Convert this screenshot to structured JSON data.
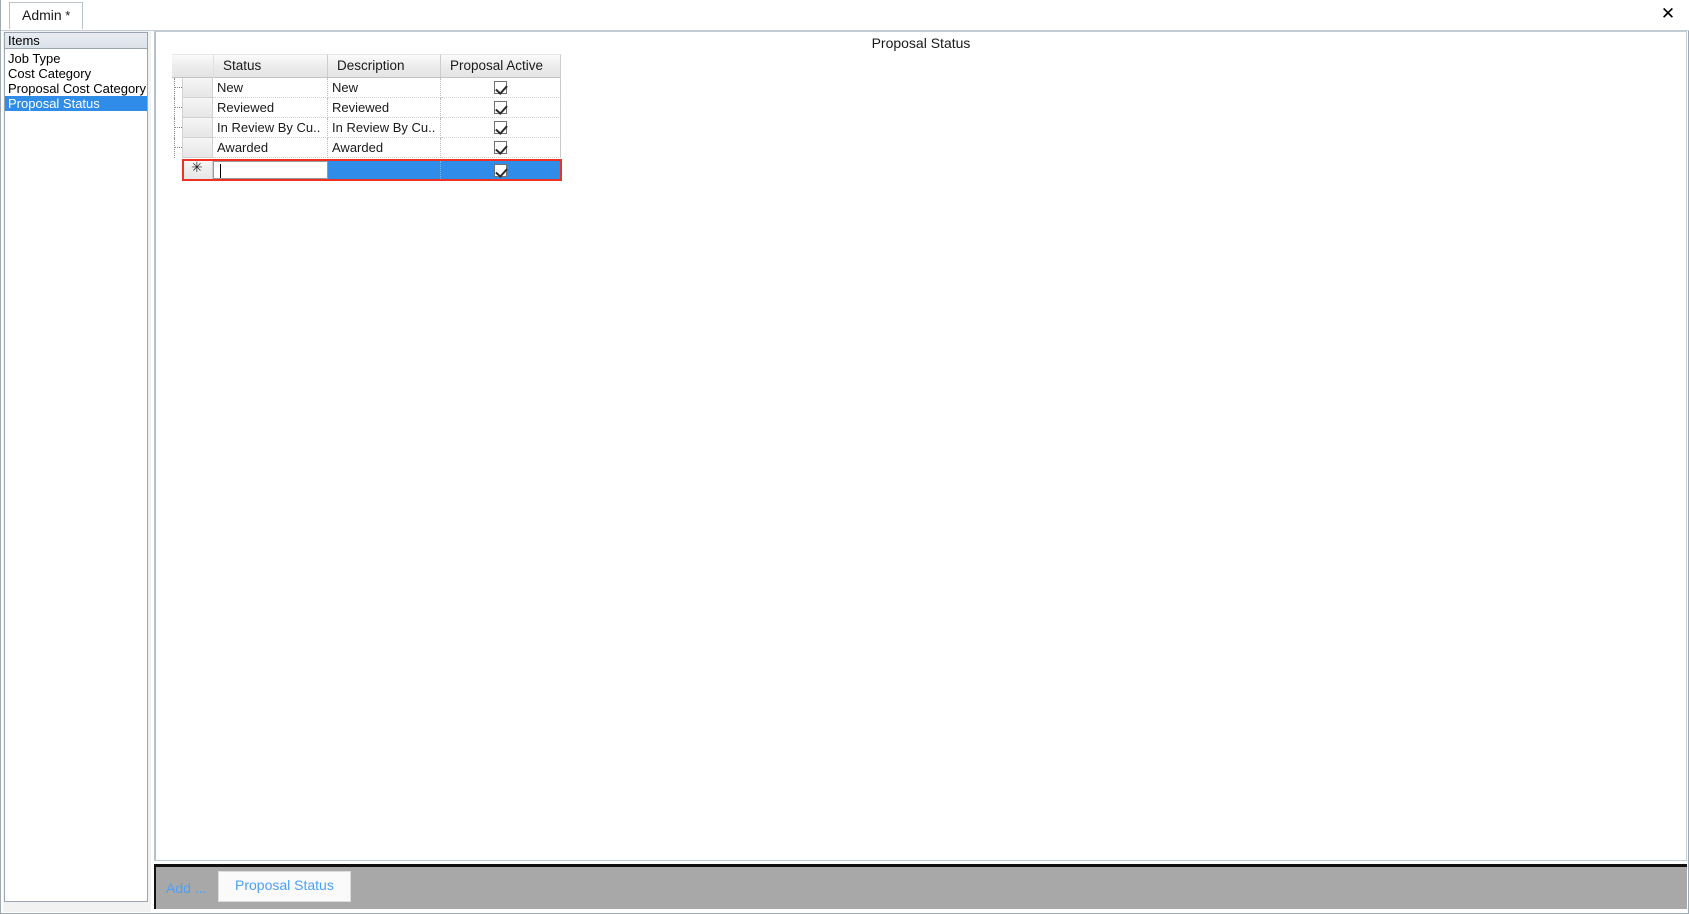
{
  "window": {
    "close_label": "✕"
  },
  "tabstrip": {
    "tabs": [
      {
        "label": "Admin",
        "dirty_marker": " *"
      }
    ]
  },
  "sidebar": {
    "header": "Items",
    "items": [
      {
        "label": "Job Type",
        "selected": false
      },
      {
        "label": "Cost Category",
        "selected": false
      },
      {
        "label": "Proposal Cost Category",
        "selected": false
      },
      {
        "label": "Proposal Status",
        "selected": true
      }
    ]
  },
  "main": {
    "title": "Proposal Status",
    "grid": {
      "columns": [
        {
          "key": "status",
          "label": "Status"
        },
        {
          "key": "description",
          "label": "Description"
        },
        {
          "key": "proposal_active",
          "label": "Proposal Active"
        }
      ],
      "rows": [
        {
          "status": "New",
          "description": "New",
          "proposal_active": true
        },
        {
          "status": "Reviewed",
          "description": "Reviewed",
          "proposal_active": true
        },
        {
          "status": "In Review By Cu..",
          "description": "In Review By Cu..",
          "proposal_active": true
        },
        {
          "status": "Awarded",
          "description": "Awarded",
          "proposal_active": true
        }
      ],
      "new_row": {
        "row_header_glyph": "✳",
        "status_value": "",
        "description_value": "",
        "proposal_active": true,
        "has_validation_error": true,
        "error_border_color": "#ef3124",
        "selection_color": "#2f8ce8"
      }
    }
  },
  "bottom_bar": {
    "add_label": "Add ...",
    "tabs": [
      {
        "label": "Proposal Status",
        "active": true
      }
    ]
  },
  "colors": {
    "selection_blue": "#2f8ce8",
    "link_blue": "#4da0f5",
    "error_red": "#ef3124",
    "bottom_bar_gray": "#a8a8a8"
  }
}
